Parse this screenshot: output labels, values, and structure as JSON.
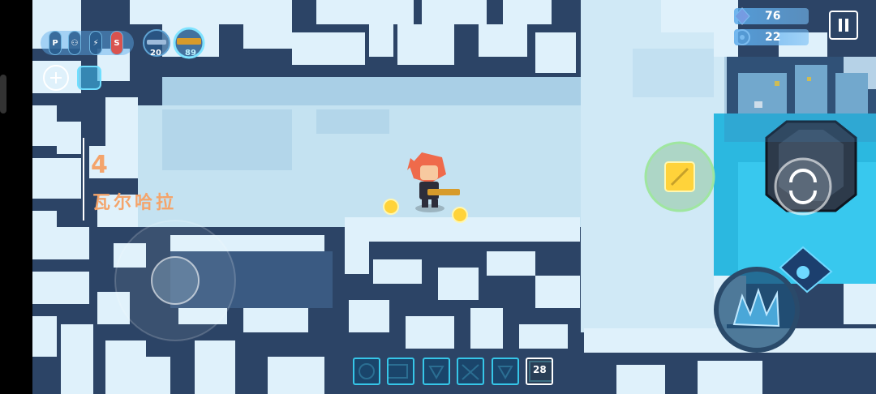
{
  "hud": {
    "gems": "76",
    "energy": "22",
    "buffs": [
      "P",
      "⚇",
      "⚡",
      "S"
    ],
    "weapon_1_ammo": "20",
    "weapon_2_ammo": "89"
  },
  "level": {
    "number": "4",
    "name": "瓦尔哈拉"
  },
  "skill_bar": {
    "bag_count": "28"
  },
  "colors": {
    "ice_light": "#dff1fb",
    "ice_dark": "#2c4466",
    "water": "#2bb8e0",
    "accent": "#ffd33a",
    "level_text": "#f4a46b"
  }
}
